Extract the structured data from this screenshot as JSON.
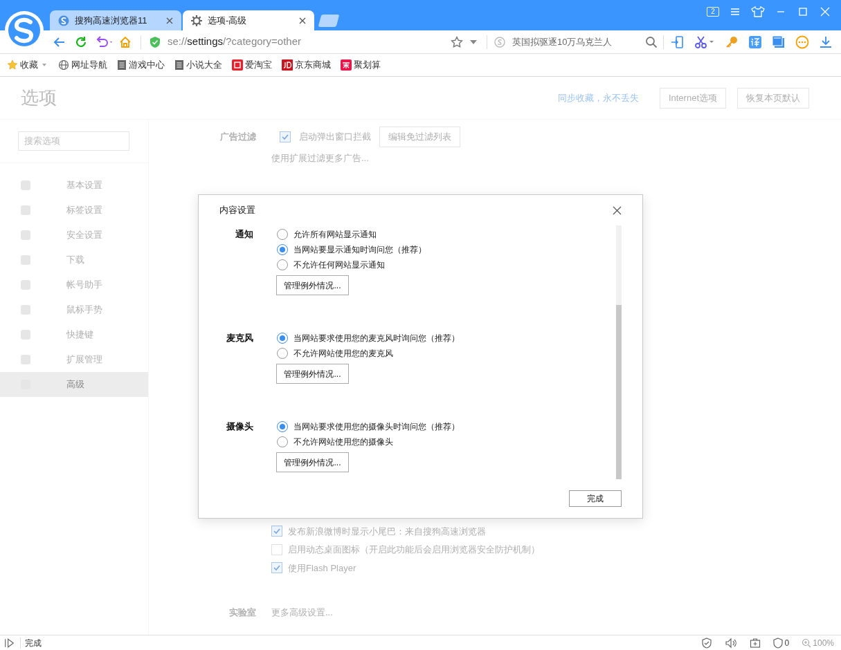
{
  "window_controls": {
    "tab_count": "2"
  },
  "tabs": [
    {
      "title": "搜狗高速浏览器11",
      "selected": false
    },
    {
      "title": "选项-高级",
      "selected": true
    }
  ],
  "address_bar": {
    "scheme": "se://",
    "host": "settings",
    "path": "/?category=other"
  },
  "search_box": {
    "placeholder": "英国拟驱逐10万乌克兰人"
  },
  "bookmarks": [
    {
      "label": "收藏"
    },
    {
      "label": "网址导航"
    },
    {
      "label": "游戏中心"
    },
    {
      "label": "小说大全"
    },
    {
      "label": "爱淘宝"
    },
    {
      "label": "京东商城"
    },
    {
      "label": "聚划算"
    }
  ],
  "page": {
    "title": "选项",
    "sync_link": "同步收藏，永不丢失",
    "buttons": [
      "Internet选项",
      "恢复本页默认"
    ],
    "search": {
      "placeholder": "搜索选项"
    },
    "sidebar": [
      {
        "label": "基本设置",
        "selected": false
      },
      {
        "label": "标签设置",
        "selected": false
      },
      {
        "label": "安全设置",
        "selected": false
      },
      {
        "label": "下载",
        "selected": false
      },
      {
        "label": "帐号助手",
        "selected": false
      },
      {
        "label": "鼠标手势",
        "selected": false
      },
      {
        "label": "快捷键",
        "selected": false
      },
      {
        "label": "扩展管理",
        "selected": false
      },
      {
        "label": "高级",
        "selected": true
      }
    ],
    "ad_filter": {
      "label": "广告过滤",
      "checkbox": {
        "label": "启动弹出窗口拦截",
        "checked": true
      },
      "button": "编辑免过滤列表",
      "link": "使用扩展过滤更多广告..."
    },
    "options": [
      {
        "label": "发布新浪微博时显示小尾巴：来自搜狗高速浏览器",
        "checked": true
      },
      {
        "label": "启用动态桌面图标（开启此功能后会启用浏览器安全防护机制）",
        "checked": false
      },
      {
        "label": "使用Flash Player",
        "checked": true
      }
    ],
    "lab": {
      "label": "实验室",
      "link": "更多高级设置..."
    }
  },
  "dialog": {
    "title": "内容设置",
    "sections": [
      {
        "label": "通知",
        "options": [
          {
            "label": "允许所有网站显示通知",
            "selected": false
          },
          {
            "label": "当网站要显示通知时询问您（推荐）",
            "selected": true
          },
          {
            "label": "不允许任何网站显示通知",
            "selected": false
          }
        ],
        "button": "管理例外情况..."
      },
      {
        "label": "麦克风",
        "options": [
          {
            "label": "当网站要求使用您的麦克风时询问您（推荐）",
            "selected": true
          },
          {
            "label": "不允许网站使用您的麦克风",
            "selected": false
          }
        ],
        "button": "管理例外情况..."
      },
      {
        "label": "摄像头",
        "options": [
          {
            "label": "当网站要求使用您的摄像头时询问您（推荐）",
            "selected": true
          },
          {
            "label": "不允许网站使用您的摄像头",
            "selected": false
          }
        ],
        "button": "管理例外情况..."
      }
    ],
    "done_button": "完成"
  },
  "status_bar": {
    "text": "完成",
    "ad_count": "0",
    "zoom": "100%"
  }
}
